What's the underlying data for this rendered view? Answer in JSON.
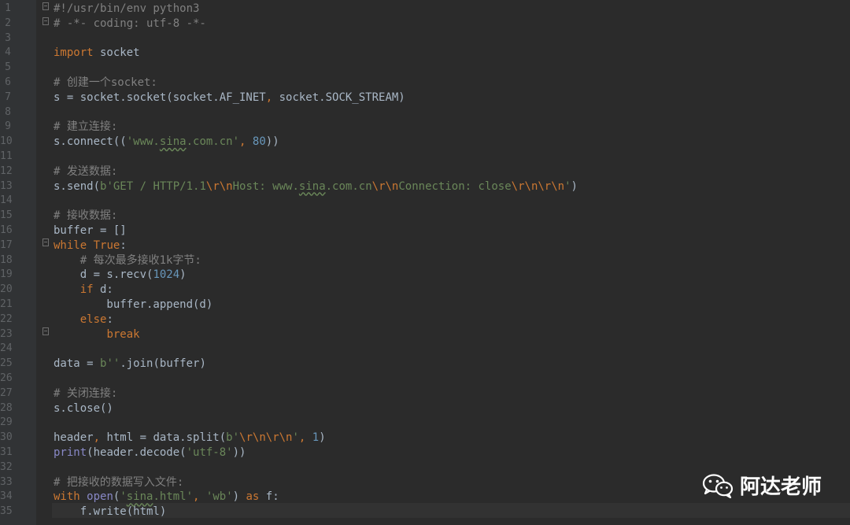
{
  "code": {
    "lines": [
      {
        "n": "1",
        "text": "#!/usr/bin/env python3"
      },
      {
        "n": "2",
        "text": "# -*- coding: utf-8 -*-"
      },
      {
        "n": "3",
        "text": ""
      },
      {
        "n": "4",
        "text": "import socket"
      },
      {
        "n": "5",
        "text": ""
      },
      {
        "n": "6",
        "text": "# 创建一个socket:"
      },
      {
        "n": "7",
        "text": "s = socket.socket(socket.AF_INET, socket.SOCK_STREAM)"
      },
      {
        "n": "8",
        "text": ""
      },
      {
        "n": "9",
        "text": "# 建立连接:"
      },
      {
        "n": "10",
        "text": "s.connect(('www.sina.com.cn', 80))"
      },
      {
        "n": "11",
        "text": ""
      },
      {
        "n": "12",
        "text": "# 发送数据:"
      },
      {
        "n": "13",
        "text": "s.send(b'GET / HTTP/1.1\\r\\nHost: www.sina.com.cn\\r\\nConnection: close\\r\\n\\r\\n')"
      },
      {
        "n": "14",
        "text": ""
      },
      {
        "n": "15",
        "text": "# 接收数据:"
      },
      {
        "n": "16",
        "text": "buffer = []"
      },
      {
        "n": "17",
        "text": "while True:"
      },
      {
        "n": "18",
        "text": "    # 每次最多接收1k字节:"
      },
      {
        "n": "19",
        "text": "    d = s.recv(1024)"
      },
      {
        "n": "20",
        "text": "    if d:"
      },
      {
        "n": "21",
        "text": "        buffer.append(d)"
      },
      {
        "n": "22",
        "text": "    else:"
      },
      {
        "n": "23",
        "text": "        break"
      },
      {
        "n": "24",
        "text": ""
      },
      {
        "n": "25",
        "text": "data = b''.join(buffer)"
      },
      {
        "n": "26",
        "text": ""
      },
      {
        "n": "27",
        "text": "# 关闭连接:"
      },
      {
        "n": "28",
        "text": "s.close()"
      },
      {
        "n": "29",
        "text": ""
      },
      {
        "n": "30",
        "text": "header, html = data.split(b'\\r\\n\\r\\n', 1)"
      },
      {
        "n": "31",
        "text": "print(header.decode('utf-8'))"
      },
      {
        "n": "32",
        "text": ""
      },
      {
        "n": "33",
        "text": "# 把接收的数据写入文件:"
      },
      {
        "n": "34",
        "text": "with open('sina.html', 'wb') as f:"
      },
      {
        "n": "35",
        "text": "    f.write(html)"
      }
    ]
  },
  "watermark": {
    "text": "阿达老师",
    "icon": "wechat-icon"
  },
  "colors": {
    "background": "#2b2b2b",
    "keyword": "#cc7832",
    "comment": "#808080",
    "string": "#6a8759",
    "number": "#6897bb",
    "text": "#a9b7c6",
    "line_number": "#606366"
  }
}
